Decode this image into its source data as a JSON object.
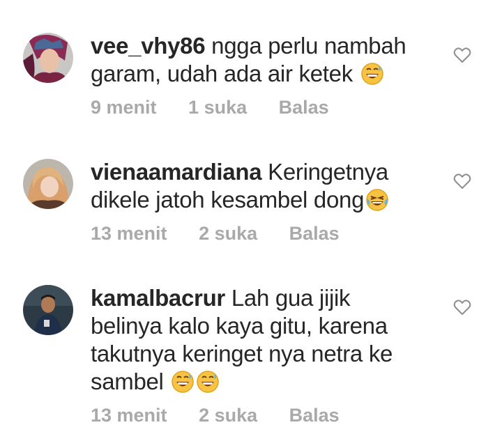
{
  "comments": [
    {
      "username": "vee_vhy86",
      "text_lines": [
        "ngga perlu nambah",
        "garam, udah ada air ketek"
      ],
      "emojis": [
        "grinning-sweat-emoji"
      ],
      "time": "9 menit",
      "likes": "1 suka",
      "reply": "Balas"
    },
    {
      "username": "vienaamardiana",
      "text_lines": [
        "Keringetnya",
        "dikele jatoh kesambel dong"
      ],
      "emojis": [
        "laughing-tears-emoji"
      ],
      "time": "13 menit",
      "likes": "2 suka",
      "reply": "Balas"
    },
    {
      "username": "kamalbacrur",
      "text_lines": [
        "Lah gua jijik",
        "belinya kalo kaya gitu, karena",
        "takutnya keringet nya netra ke",
        "sambel"
      ],
      "emojis": [
        "grinning-sweat-emoji",
        "grinning-sweat-emoji"
      ],
      "time": "13 menit",
      "likes": "2 suka",
      "reply": "Balas"
    }
  ],
  "colors": {
    "text": "#262626",
    "meta": "#a9a9a9",
    "heart": "#8e8e8e"
  },
  "icons": {
    "like": "heart-outline-icon"
  }
}
